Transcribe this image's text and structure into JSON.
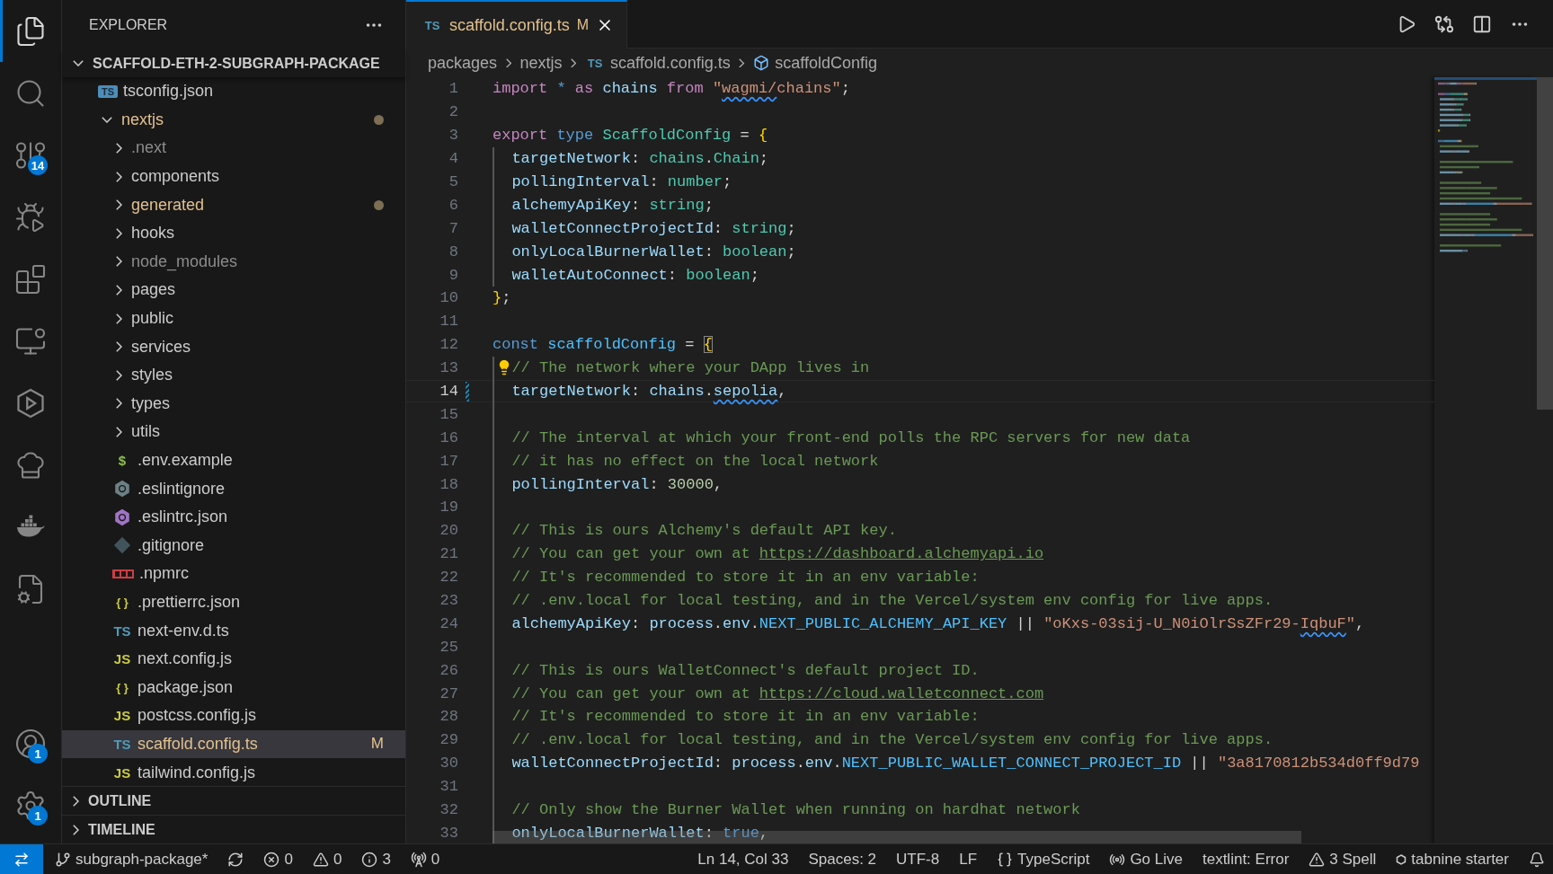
{
  "activity_bar": {
    "items": [
      {
        "kind": "explorer",
        "selected": true
      },
      {
        "kind": "search",
        "selected": false
      },
      {
        "kind": "scm",
        "selected": false,
        "badge": "14"
      },
      {
        "kind": "debug",
        "selected": false
      },
      {
        "kind": "extensions",
        "selected": false
      },
      {
        "kind": "remote",
        "selected": false
      },
      {
        "kind": "hexagon",
        "selected": false
      },
      {
        "kind": "chef",
        "selected": false
      },
      {
        "kind": "containers",
        "selected": false
      },
      {
        "kind": "cppconfig",
        "selected": false
      }
    ],
    "bottom_items": [
      {
        "kind": "accounts",
        "badge": "1"
      },
      {
        "kind": "settings",
        "badge": "1"
      }
    ]
  },
  "sidebar": {
    "title": "EXPLORER",
    "root": {
      "label": "SCAFFOLD-ETH-2-SUBGRAPH-PACKAGE",
      "expanded": true,
      "children": [
        {
          "name": "tsconfig.json",
          "kind": "tsconfig",
          "icon_text": "TS",
          "modified": false,
          "ignored": false,
          "selected": false
        },
        {
          "name": "nextjs",
          "kind": "folder",
          "expanded": true,
          "modified": true,
          "ignored": false,
          "selected": false,
          "children": [
            {
              "name": ".next",
              "kind": "folder",
              "expanded": false,
              "modified": false,
              "ignored": true,
              "selected": false
            },
            {
              "name": "components",
              "kind": "folder",
              "expanded": false,
              "modified": false,
              "ignored": false,
              "selected": false
            },
            {
              "name": "generated",
              "kind": "folder",
              "expanded": false,
              "modified": true,
              "ignored": false,
              "selected": false
            },
            {
              "name": "hooks",
              "kind": "folder",
              "expanded": false,
              "modified": false,
              "ignored": false,
              "selected": false
            },
            {
              "name": "node_modules",
              "kind": "folder",
              "expanded": false,
              "modified": false,
              "ignored": true,
              "selected": false
            },
            {
              "name": "pages",
              "kind": "folder",
              "expanded": false,
              "modified": false,
              "ignored": false,
              "selected": false
            },
            {
              "name": "public",
              "kind": "folder",
              "expanded": false,
              "modified": false,
              "ignored": false,
              "selected": false
            },
            {
              "name": "services",
              "kind": "folder",
              "expanded": false,
              "modified": false,
              "ignored": false,
              "selected": false
            },
            {
              "name": "styles",
              "kind": "folder",
              "expanded": false,
              "modified": false,
              "ignored": false,
              "selected": false
            },
            {
              "name": "types",
              "kind": "folder",
              "expanded": false,
              "modified": false,
              "ignored": false,
              "selected": false
            },
            {
              "name": "utils",
              "kind": "folder",
              "expanded": false,
              "modified": false,
              "ignored": false,
              "selected": false
            },
            {
              "name": ".env.example",
              "kind": "env",
              "icon_text": "$",
              "modified": false,
              "ignored": false,
              "selected": false
            },
            {
              "name": ".eslintignore",
              "kind": "eslintignore",
              "modified": false,
              "ignored": false,
              "selected": false
            },
            {
              "name": ".eslintrc.json",
              "kind": "eslint",
              "modified": false,
              "ignored": false,
              "selected": false
            },
            {
              "name": ".gitignore",
              "kind": "git",
              "modified": false,
              "ignored": false,
              "selected": false
            },
            {
              "name": ".npmrc",
              "kind": "npm",
              "modified": false,
              "ignored": false,
              "selected": false
            },
            {
              "name": ".prettierrc.json",
              "kind": "json",
              "icon_text": "{ }",
              "modified": false,
              "ignored": false,
              "selected": false
            },
            {
              "name": "next-env.d.ts",
              "kind": "typescript",
              "icon_text": "TS",
              "modified": false,
              "ignored": false,
              "selected": false
            },
            {
              "name": "next.config.js",
              "kind": "javascript",
              "icon_text": "JS",
              "modified": false,
              "ignored": false,
              "selected": false
            },
            {
              "name": "package.json",
              "kind": "json",
              "icon_text": "{ }",
              "modified": false,
              "ignored": false,
              "selected": false
            },
            {
              "name": "postcss.config.js",
              "kind": "javascript",
              "icon_text": "JS",
              "modified": false,
              "ignored": false,
              "selected": false
            },
            {
              "name": "scaffold.config.ts",
              "kind": "typescript",
              "icon_text": "TS",
              "modified": true,
              "badge": "M",
              "ignored": false,
              "selected": true
            },
            {
              "name": "tailwind.config.js",
              "kind": "javascript",
              "icon_text": "JS",
              "modified": false,
              "ignored": false,
              "selected": false
            }
          ]
        }
      ]
    },
    "sections": [
      {
        "title": "OUTLINE",
        "expanded": false
      },
      {
        "title": "TIMELINE",
        "expanded": false
      }
    ]
  },
  "editor": {
    "tab": {
      "icon_text": "TS",
      "title": "scaffold.config.ts",
      "badge": "M",
      "selected": true,
      "modified": true
    },
    "breadcrumbs": [
      {
        "label": "packages",
        "kind": "folder"
      },
      {
        "label": "nextjs",
        "kind": "folder"
      },
      {
        "label": "scaffold.config.ts",
        "kind": "file",
        "icon_text": "TS"
      },
      {
        "label": "scaffoldConfig",
        "kind": "symbol"
      }
    ],
    "lines": [
      {
        "number": "1",
        "current": false,
        "indented": false,
        "tokens": [
          {
            "kind": "keyword",
            "text": "import "
          },
          {
            "kind": "storage",
            "text": "* "
          },
          {
            "kind": "keyword",
            "text": "as "
          },
          {
            "kind": "variable",
            "text": "chains "
          },
          {
            "kind": "keyword",
            "text": "from "
          },
          {
            "kind": "string",
            "text": "\""
          },
          {
            "kind": "string",
            "text": "wagmi/",
            "squiggly": true
          },
          {
            "kind": "string",
            "text": "chains\""
          },
          {
            "kind": "punct",
            "text": ";"
          }
        ]
      },
      {
        "number": "2",
        "current": false,
        "indented": false
      },
      {
        "number": "3",
        "current": false,
        "indented": false,
        "tokens": [
          {
            "kind": "keyword",
            "text": "export "
          },
          {
            "kind": "storage",
            "text": "type "
          },
          {
            "kind": "type",
            "text": "ScaffoldConfig"
          },
          {
            "kind": "punct",
            "text": " = "
          },
          {
            "kind": "brace",
            "text": "{"
          }
        ]
      },
      {
        "number": "4",
        "current": false,
        "indented": true,
        "tokens": [
          {
            "kind": "variable",
            "text": "targetNetwork"
          },
          {
            "kind": "punct",
            "text": ": "
          },
          {
            "kind": "type",
            "text": "chains"
          },
          {
            "kind": "punct",
            "text": "."
          },
          {
            "kind": "type",
            "text": "Chain"
          },
          {
            "kind": "punct",
            "text": ";"
          }
        ]
      },
      {
        "number": "5",
        "current": false,
        "indented": true,
        "tokens": [
          {
            "kind": "variable",
            "text": "pollingInterval"
          },
          {
            "kind": "punct",
            "text": ": "
          },
          {
            "kind": "type",
            "text": "number"
          },
          {
            "kind": "punct",
            "text": ";"
          }
        ]
      },
      {
        "number": "6",
        "current": false,
        "indented": true,
        "tokens": [
          {
            "kind": "variable",
            "text": "alchemyApiKey"
          },
          {
            "kind": "punct",
            "text": ": "
          },
          {
            "kind": "type",
            "text": "string"
          },
          {
            "kind": "punct",
            "text": ";"
          }
        ]
      },
      {
        "number": "7",
        "current": false,
        "indented": true,
        "tokens": [
          {
            "kind": "variable",
            "text": "walletConnectProjectId"
          },
          {
            "kind": "punct",
            "text": ": "
          },
          {
            "kind": "type",
            "text": "string"
          },
          {
            "kind": "punct",
            "text": ";"
          }
        ]
      },
      {
        "number": "8",
        "current": false,
        "indented": true,
        "tokens": [
          {
            "kind": "variable",
            "text": "onlyLocalBurnerWallet"
          },
          {
            "kind": "punct",
            "text": ": "
          },
          {
            "kind": "type",
            "text": "boolean"
          },
          {
            "kind": "punct",
            "text": ";"
          }
        ]
      },
      {
        "number": "9",
        "current": false,
        "indented": true,
        "tokens": [
          {
            "kind": "variable",
            "text": "walletAutoConnect"
          },
          {
            "kind": "punct",
            "text": ": "
          },
          {
            "kind": "type",
            "text": "boolean"
          },
          {
            "kind": "punct",
            "text": ";"
          }
        ]
      },
      {
        "number": "10",
        "current": false,
        "indented": false,
        "tokens": [
          {
            "kind": "brace",
            "text": "}"
          },
          {
            "kind": "punct",
            "text": ";"
          }
        ]
      },
      {
        "number": "11",
        "current": false,
        "indented": false
      },
      {
        "number": "12",
        "current": false,
        "indented": false,
        "tokens": [
          {
            "kind": "storage",
            "text": "const "
          },
          {
            "kind": "constant",
            "text": "scaffoldConfig"
          },
          {
            "kind": "punct",
            "text": " = "
          },
          {
            "kind": "brace",
            "text": "{",
            "matched": true
          }
        ]
      },
      {
        "number": "13",
        "current": false,
        "indented": true,
        "lightbulb": true,
        "tokens": [
          {
            "kind": "comment",
            "text": "// The network where your DApp lives in"
          }
        ]
      },
      {
        "number": "14",
        "current": true,
        "indented": true,
        "tokens": [
          {
            "kind": "variable",
            "text": "targetNetwork"
          },
          {
            "kind": "punct",
            "text": ": "
          },
          {
            "kind": "variable",
            "text": "chains"
          },
          {
            "kind": "punct",
            "text": "."
          },
          {
            "kind": "variable",
            "text": "sepolia",
            "squiggly": true
          },
          {
            "kind": "punct",
            "text": ","
          }
        ]
      },
      {
        "number": "15",
        "current": false,
        "indented": true
      },
      {
        "number": "16",
        "current": false,
        "indented": true,
        "tokens": [
          {
            "kind": "comment",
            "text": "// The interval at which your front-end polls the RPC servers for new data"
          }
        ]
      },
      {
        "number": "17",
        "current": false,
        "indented": true,
        "tokens": [
          {
            "kind": "comment",
            "text": "// it has no effect on the local network"
          }
        ]
      },
      {
        "number": "18",
        "current": false,
        "indented": true,
        "tokens": [
          {
            "kind": "variable",
            "text": "pollingInterval"
          },
          {
            "kind": "punct",
            "text": ": "
          },
          {
            "kind": "number",
            "text": "30000"
          },
          {
            "kind": "punct",
            "text": ","
          }
        ]
      },
      {
        "number": "19",
        "current": false,
        "indented": true
      },
      {
        "number": "20",
        "current": false,
        "indented": true,
        "tokens": [
          {
            "kind": "comment",
            "text": "// This is ours Alchemy's default API key."
          }
        ]
      },
      {
        "number": "21",
        "current": false,
        "indented": true,
        "tokens": [
          {
            "kind": "comment",
            "text": "// You can get your own at "
          },
          {
            "kind": "link",
            "text": "https://dashboard.alchemyapi.io"
          }
        ]
      },
      {
        "number": "22",
        "current": false,
        "indented": true,
        "tokens": [
          {
            "kind": "comment",
            "text": "// It's recommended to store it in an env variable:"
          }
        ]
      },
      {
        "number": "23",
        "current": false,
        "indented": true,
        "tokens": [
          {
            "kind": "comment",
            "text": "// .env.local for local testing, and in the Vercel/system env config for live apps."
          }
        ]
      },
      {
        "number": "24",
        "current": false,
        "indented": true,
        "tokens": [
          {
            "kind": "variable",
            "text": "alchemyApiKey"
          },
          {
            "kind": "punct",
            "text": ": "
          },
          {
            "kind": "variable",
            "text": "process"
          },
          {
            "kind": "punct",
            "text": "."
          },
          {
            "kind": "variable",
            "text": "env"
          },
          {
            "kind": "punct",
            "text": "."
          },
          {
            "kind": "constant",
            "text": "NEXT_PUBLIC_ALCHEMY_API_KEY"
          },
          {
            "kind": "punct",
            "text": " || "
          },
          {
            "kind": "string",
            "text": "\"oKxs-03sij-U_N0iOlrSsZFr29-"
          },
          {
            "kind": "string",
            "text": "IqbuF",
            "squiggly": true
          },
          {
            "kind": "string",
            "text": "\""
          },
          {
            "kind": "punct",
            "text": ","
          }
        ]
      },
      {
        "number": "25",
        "current": false,
        "indented": true
      },
      {
        "number": "26",
        "current": false,
        "indented": true,
        "tokens": [
          {
            "kind": "comment",
            "text": "// This is ours WalletConnect's default project ID."
          }
        ]
      },
      {
        "number": "27",
        "current": false,
        "indented": true,
        "tokens": [
          {
            "kind": "comment",
            "text": "// You can get your own at "
          },
          {
            "kind": "link",
            "text": "https://cloud.walletconnect.com"
          }
        ]
      },
      {
        "number": "28",
        "current": false,
        "indented": true,
        "tokens": [
          {
            "kind": "comment",
            "text": "// It's recommended to store it in an env variable:"
          }
        ]
      },
      {
        "number": "29",
        "current": false,
        "indented": true,
        "tokens": [
          {
            "kind": "comment",
            "text": "// .env.local for local testing, and in the Vercel/system env config for live apps."
          }
        ]
      },
      {
        "number": "30",
        "current": false,
        "indented": true,
        "tokens": [
          {
            "kind": "variable",
            "text": "walletConnectProjectId"
          },
          {
            "kind": "punct",
            "text": ": "
          },
          {
            "kind": "variable",
            "text": "process"
          },
          {
            "kind": "punct",
            "text": "."
          },
          {
            "kind": "variable",
            "text": "env"
          },
          {
            "kind": "punct",
            "text": "."
          },
          {
            "kind": "constant",
            "text": "NEXT_PUBLIC_WALLET_CONNECT_PROJECT_ID"
          },
          {
            "kind": "punct",
            "text": " || "
          },
          {
            "kind": "string",
            "text": "\"3a8170812b534d0ff9d79"
          }
        ]
      },
      {
        "number": "31",
        "current": false,
        "indented": true
      },
      {
        "number": "32",
        "current": false,
        "indented": true,
        "tokens": [
          {
            "kind": "comment",
            "text": "// Only show the Burner Wallet when running on hardhat network"
          }
        ]
      },
      {
        "number": "33",
        "current": false,
        "indented": true,
        "tokens": [
          {
            "kind": "variable",
            "text": "onlyLocalBurnerWallet"
          },
          {
            "kind": "punct",
            "text": ": "
          },
          {
            "kind": "storage",
            "text": "true"
          },
          {
            "kind": "punct",
            "text": ","
          }
        ]
      }
    ]
  },
  "status_bar": {
    "left": [
      {
        "kind": "branch",
        "text": "subgraph-package*"
      },
      {
        "kind": "sync"
      },
      {
        "kind": "errors",
        "text": "0"
      },
      {
        "kind": "warnings",
        "text": "0"
      },
      {
        "kind": "info",
        "text": "3"
      },
      {
        "kind": "ports",
        "text": "0"
      }
    ],
    "right": [
      {
        "kind": "plain",
        "text": "Ln 14, Col 33"
      },
      {
        "kind": "plain",
        "text": "Spaces: 2"
      },
      {
        "kind": "plain",
        "text": "UTF-8"
      },
      {
        "kind": "plain",
        "text": "LF"
      },
      {
        "kind": "language",
        "text": "TypeScript"
      },
      {
        "kind": "golive",
        "text": "Go Live"
      },
      {
        "kind": "plain",
        "text": "textlint: Error"
      },
      {
        "kind": "warnings",
        "text": "3 Spell"
      },
      {
        "kind": "tabnine",
        "text": "tabnine starter"
      },
      {
        "kind": "bell"
      }
    ]
  }
}
